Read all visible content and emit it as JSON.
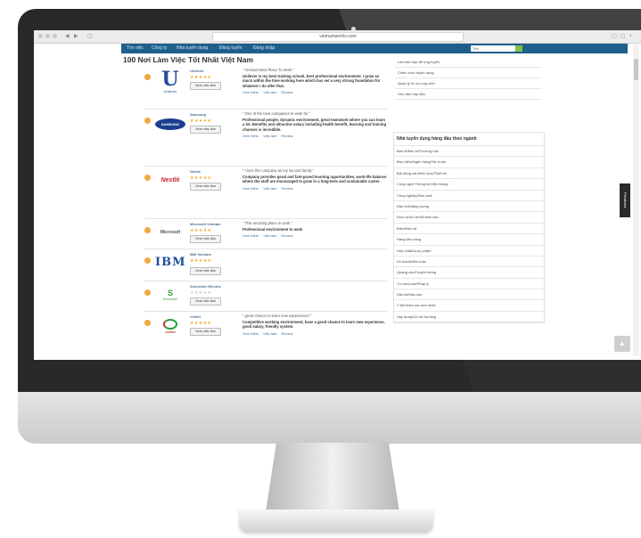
{
  "browser": {
    "url": "vietnamworks.com"
  },
  "topnav": {
    "items": [
      "Tìm việc",
      "Công ty",
      "Nhà tuyển dụng",
      "Đăng tuyển",
      "Đăng nhập"
    ],
    "search_placeholder": "Tìm"
  },
  "page": {
    "title": "100 Nơi Làm Việc Tốt Nhất Việt Nam"
  },
  "companies": [
    {
      "name": "Unilever",
      "rating": 5,
      "button": "Xem việc làm",
      "logo_text": "U",
      "logo_sub": "Unilever",
      "logo_color": "#1f4e9c",
      "review_title": "\" Vietnam Best Place To Work \"",
      "review_text": "Unilever is my best training school, best professional environment. I grow so much within the time working here which has set a very strong foundation for whatever I do after that.",
      "links": [
        "Xem thêm",
        "Việc làm",
        "Review"
      ]
    },
    {
      "name": "Samsung",
      "rating": 5,
      "button": "Xem việc làm",
      "logo_text": "SAMSUNG",
      "logo_color": "#1b3f8f",
      "review_title": "\" One of the best companies to work for \"",
      "review_text": "Professional people, dynamic environment, great teamwork where you can learn a lot. Benefits and attractive salary including health benefit, learning and training chances is incredible.",
      "links": [
        "Xem thêm",
        "Việc làm",
        "Review"
      ]
    },
    {
      "name": "Nestlé",
      "rating": 5,
      "button": "Xem việc làm",
      "logo_text": "Nestlé",
      "logo_color": "#c8242c",
      "review_title": "\" I love this company as my second family \"",
      "review_text": "Company provides good and fast-paced learning opportunities, work-life balance where the staff are encouraged to grow in a long-term and sustainable career.",
      "links": [
        "Xem thêm",
        "Việc làm",
        "Review"
      ]
    },
    {
      "name": "Microsoft Vietnam",
      "rating": 5,
      "button": "Xem việc làm",
      "logo_text": "Microsoft",
      "logo_color": "#555555",
      "review_title": "\" This amazing place to work \"",
      "review_text": "Professional environment to work",
      "links": [
        "Xem thêm",
        "Việc làm",
        "Review"
      ]
    },
    {
      "name": "IBM Vietnam",
      "rating": 5,
      "button": "Xem việc làm",
      "logo_text": "IBM",
      "logo_color": "#1f4e9c"
    },
    {
      "name": "Schneider Electric",
      "rating": 0,
      "button": "Xem việc làm",
      "logo_text": "Schneider",
      "logo_color": "#3a9a3a"
    },
    {
      "name": "Viettel",
      "rating": 5,
      "button": "Xem việc làm",
      "logo_text": "viettel",
      "logo_color": "#c0392b",
      "review_title": "\" great chance to learn new experiences \"",
      "review_text": "Competitive working environment, have a good chance to learn new experience, good salary, friendly system.",
      "links": [
        "Xem thêm",
        "Việc làm",
        "Review"
      ]
    }
  ],
  "sidebar": {
    "top_items": [
      "Làm thế nào để ứng tuyển",
      "Chiến lược tuyển dụng",
      "Quản lý hồ sơ ứng viên",
      "Việc làm hấp dẫn"
    ],
    "box_title": "Nhà tuyển dụng hàng đầu theo ngành",
    "box_items": [
      "Bán lẻ/Bán sỉ/Thương mại",
      "Bảo hiểm/Ngân hàng/Tài chính",
      "Bất động sản/Kiến trúc/Thiết kế",
      "Công nghệ Thông tin/Viễn thông",
      "Công nghiệp/Sản xuất",
      "Dầu khí/Năng lượng",
      "Dịch vụ/Du lịch/Khách sạn",
      "Điện/Điện tử",
      "Hàng tiêu dùng",
      "Hóa chất/Dược phẩm",
      "Kế toán/Kiểm toán",
      "Quảng cáo/Truyền thông",
      "Tư vấn/Luật/Pháp lý",
      "Vận tải/Hậu cần",
      "Y tế/Chăm sóc sức khỏe",
      "Xây dựng/Cơ sở hạ tầng"
    ]
  },
  "feedback_label": "Feedback"
}
